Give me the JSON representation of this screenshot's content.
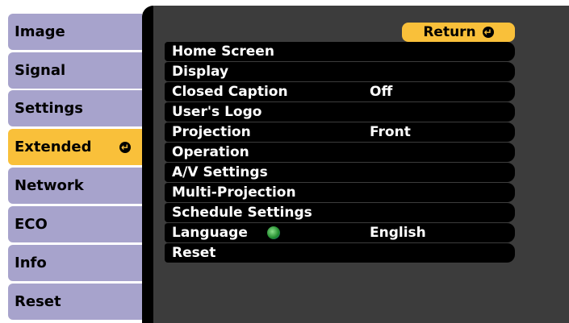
{
  "sidebar": {
    "items": [
      {
        "label": "Image"
      },
      {
        "label": "Signal"
      },
      {
        "label": "Settings"
      },
      {
        "label": "Extended",
        "active": true
      },
      {
        "label": "Network"
      },
      {
        "label": "ECO"
      },
      {
        "label": "Info"
      },
      {
        "label": "Reset"
      }
    ]
  },
  "return_button": {
    "label": "Return"
  },
  "menu": {
    "rows": [
      {
        "label": "Home Screen",
        "value": ""
      },
      {
        "label": "Display",
        "value": ""
      },
      {
        "label": "Closed Caption",
        "value": "Off"
      },
      {
        "label": "User's Logo",
        "value": ""
      },
      {
        "label": "Projection",
        "value": "Front"
      },
      {
        "label": "Operation",
        "value": ""
      },
      {
        "label": "A/V Settings",
        "value": ""
      },
      {
        "label": "Multi-Projection",
        "value": ""
      },
      {
        "label": "Schedule Settings",
        "value": ""
      },
      {
        "label": "Language",
        "value": "English",
        "icon": "globe-icon"
      },
      {
        "label": "Reset",
        "value": ""
      }
    ]
  },
  "colors": {
    "accent": "#f9c03a",
    "tab": "#a7a3cc",
    "panel": "#3c3c3c",
    "row": "#000000"
  }
}
